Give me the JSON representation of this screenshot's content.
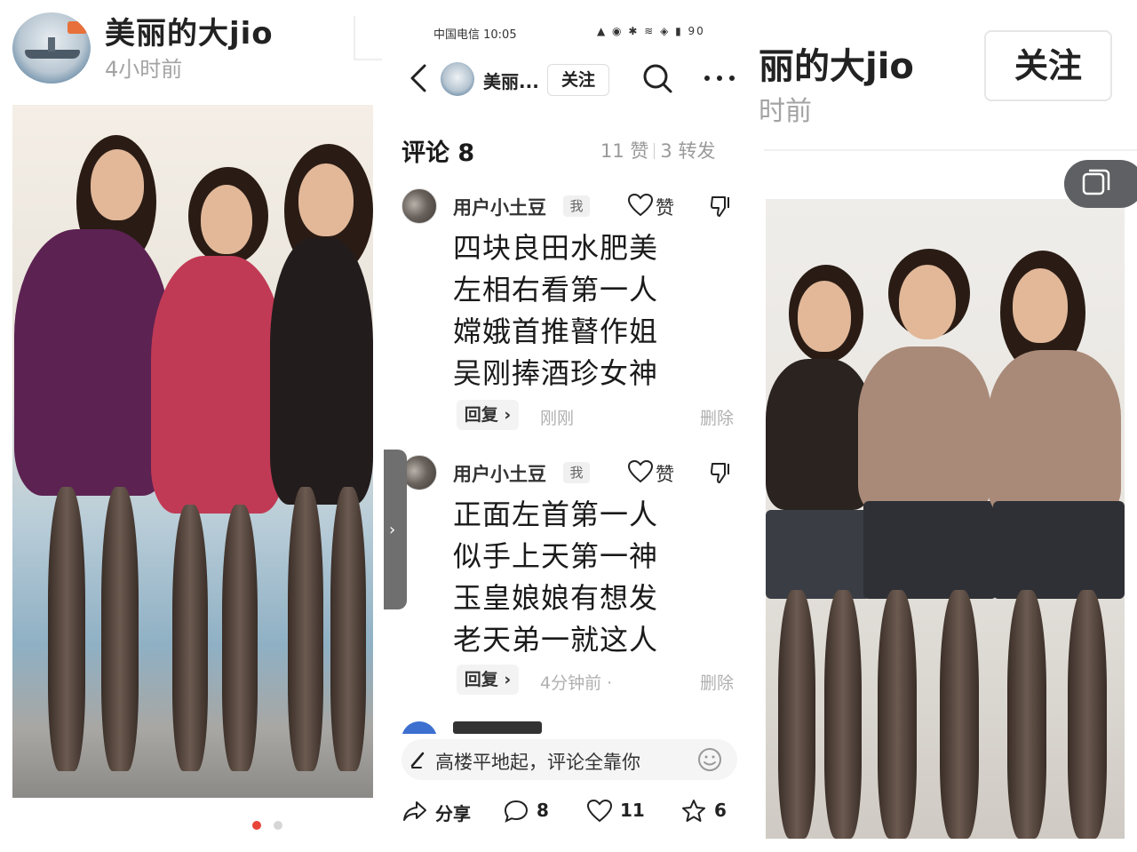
{
  "left": {
    "username": "美丽的大jio",
    "time": "4小时前",
    "carousel": {
      "current": 1,
      "total": 2
    }
  },
  "middle": {
    "status_bar": {
      "carrier_time": "中国电信 10:05",
      "battery": "90"
    },
    "header": {
      "name": "美丽...",
      "follow_label": "关注"
    },
    "comments_title": "评论 8",
    "stats": {
      "likes": "11 赞",
      "shares": "3 转发"
    },
    "comments": [
      {
        "user": "用户小土豆",
        "badge": "我",
        "like_label": "赞",
        "lines": [
          "四块良田水肥美",
          "左相右看第一人",
          "嫦娥首推瞽作姐",
          "吴刚捧酒珍女神"
        ],
        "reply_label": "回复 ›",
        "time": "刚刚",
        "delete_label": "删除"
      },
      {
        "user": "用户小土豆",
        "badge": "我",
        "like_label": "赞",
        "lines": [
          "正面左首第一人",
          "似手上天第一神",
          "玉皇娘娘有想发",
          "老天弟一就这人"
        ],
        "reply_label": "回复 ›",
        "time": "4分钟前 ·",
        "delete_label": "删除"
      }
    ],
    "input_placeholder": "高楼平地起，评论全靠你",
    "actions": [
      {
        "icon": "share-icon",
        "label": "分享"
      },
      {
        "icon": "comment-icon",
        "label": "8"
      },
      {
        "icon": "heart-icon",
        "label": "11"
      },
      {
        "icon": "star-icon",
        "label": "6"
      }
    ]
  },
  "right": {
    "username_partial": "丽的大jio",
    "time_partial": "时前",
    "follow_label": "关注"
  },
  "colors": {
    "accent_red": "#e8443a",
    "text_primary": "#1a1a1a",
    "text_secondary": "#a3a3a3"
  }
}
